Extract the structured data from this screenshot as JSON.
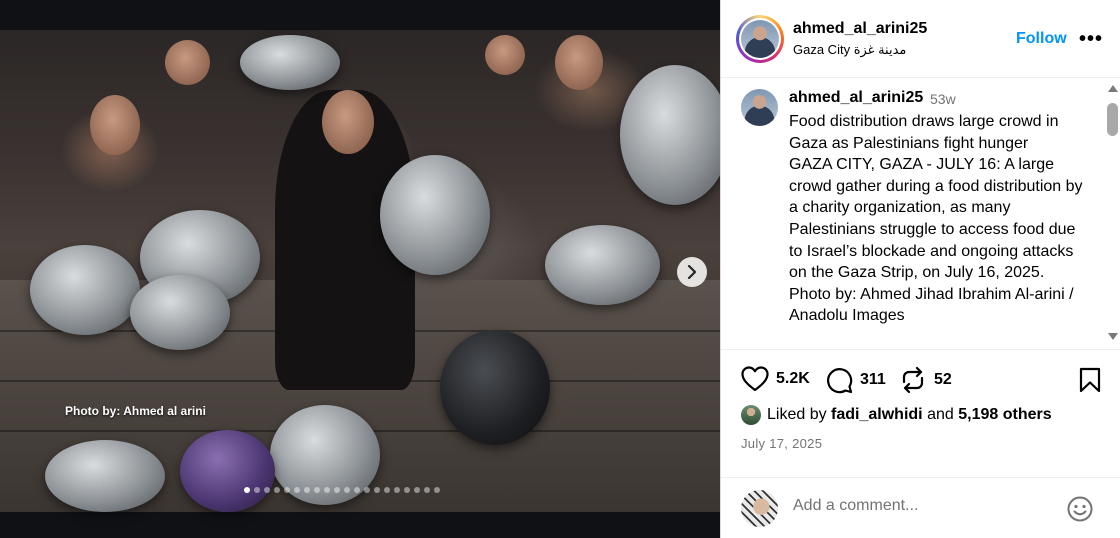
{
  "media": {
    "photo_credit": "Photo by: Ahmed al arini",
    "carousel": {
      "total_slides": 20,
      "active_index": 0
    },
    "next_icon": "chevron-right-icon"
  },
  "header": {
    "username": "ahmed_al_arini25",
    "location": "Gaza City مدينة غزة",
    "follow_label": "Follow",
    "more_icon": "more-horizontal-icon",
    "more_label": "•••"
  },
  "caption": {
    "username": "ahmed_al_arini25",
    "time": "53w",
    "text": "Food distribution draws large crowd in Gaza as Palestinians fight hunger\nGAZA CITY, GAZA - JULY 16: A large crowd gather during a food distribution by a charity organization, as many Palestinians struggle to access food due to Israel’s blockade and ongoing attacks on the Gaza Strip, on July 16, 2025.\nPhoto by: Ahmed Jihad Ibrahim Al-arini / Anadolu Images"
  },
  "actions": {
    "likes": "5.2K",
    "comments": "311",
    "reposts": "52",
    "icons": [
      "heart-icon",
      "comment-icon",
      "repost-icon",
      "bookmark-icon"
    ]
  },
  "liked_by": {
    "prefix": "Liked by",
    "user": "fadi_alwhidi",
    "and": "and",
    "others": "5,198 others"
  },
  "date": "July 17, 2025",
  "comment": {
    "placeholder": "Add a comment...",
    "emoji_icon": "emoji-icon"
  },
  "colors": {
    "accent": "#0095f6",
    "muted": "#737373",
    "media_background": "#0f1115"
  }
}
